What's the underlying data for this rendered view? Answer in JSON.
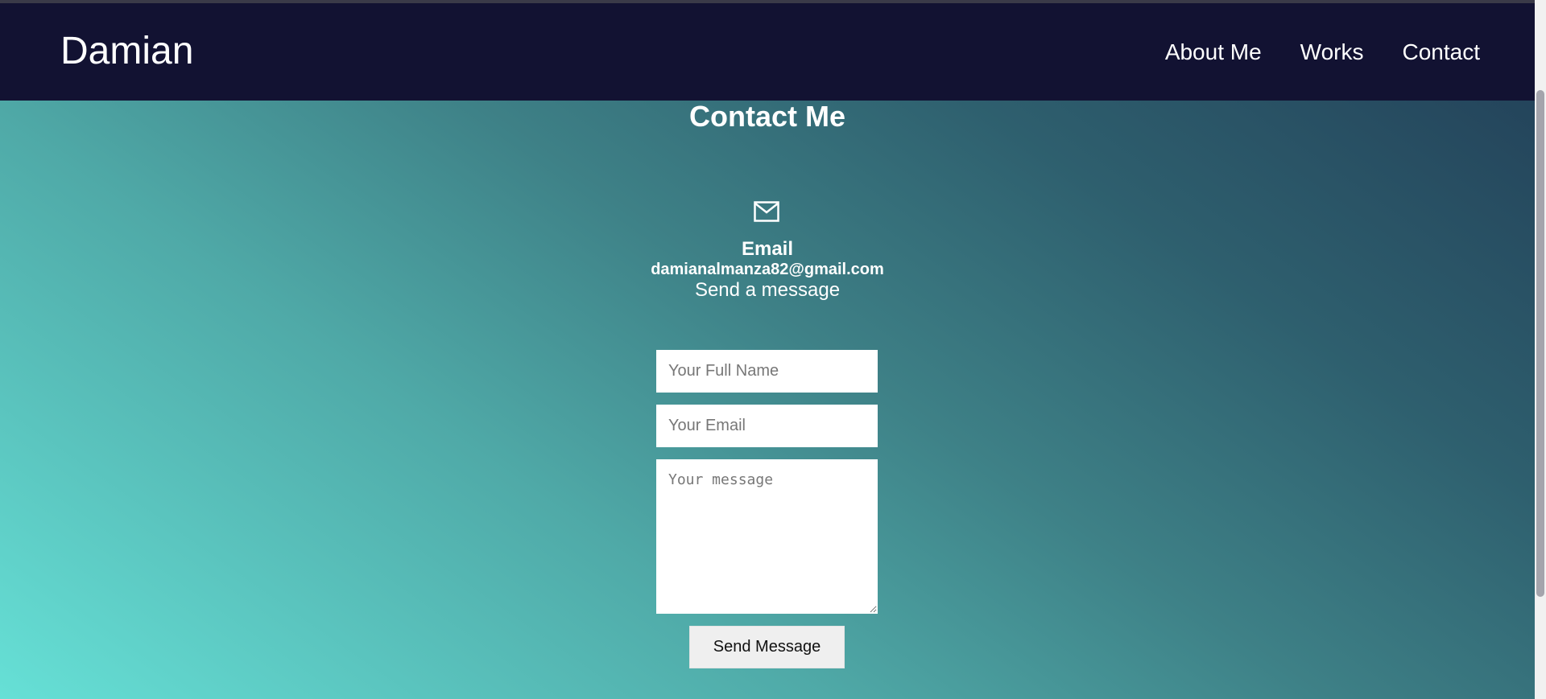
{
  "header": {
    "brand": "Damian",
    "nav": [
      {
        "label": "About Me"
      },
      {
        "label": "Works"
      },
      {
        "label": "Contact"
      }
    ]
  },
  "contact": {
    "title": "Contact Me",
    "icon": "mail-icon",
    "email_label": "Email",
    "email_value": "damianalmanza82@gmail.com",
    "subtitle": "Send a message"
  },
  "form": {
    "name_placeholder": "Your Full Name",
    "email_placeholder": "Your Email",
    "message_placeholder": "Your message",
    "submit_label": "Send Message"
  },
  "colors": {
    "header_bg": "#121232",
    "gradient_start": "#66e0d6",
    "gradient_end": "#213d56"
  }
}
